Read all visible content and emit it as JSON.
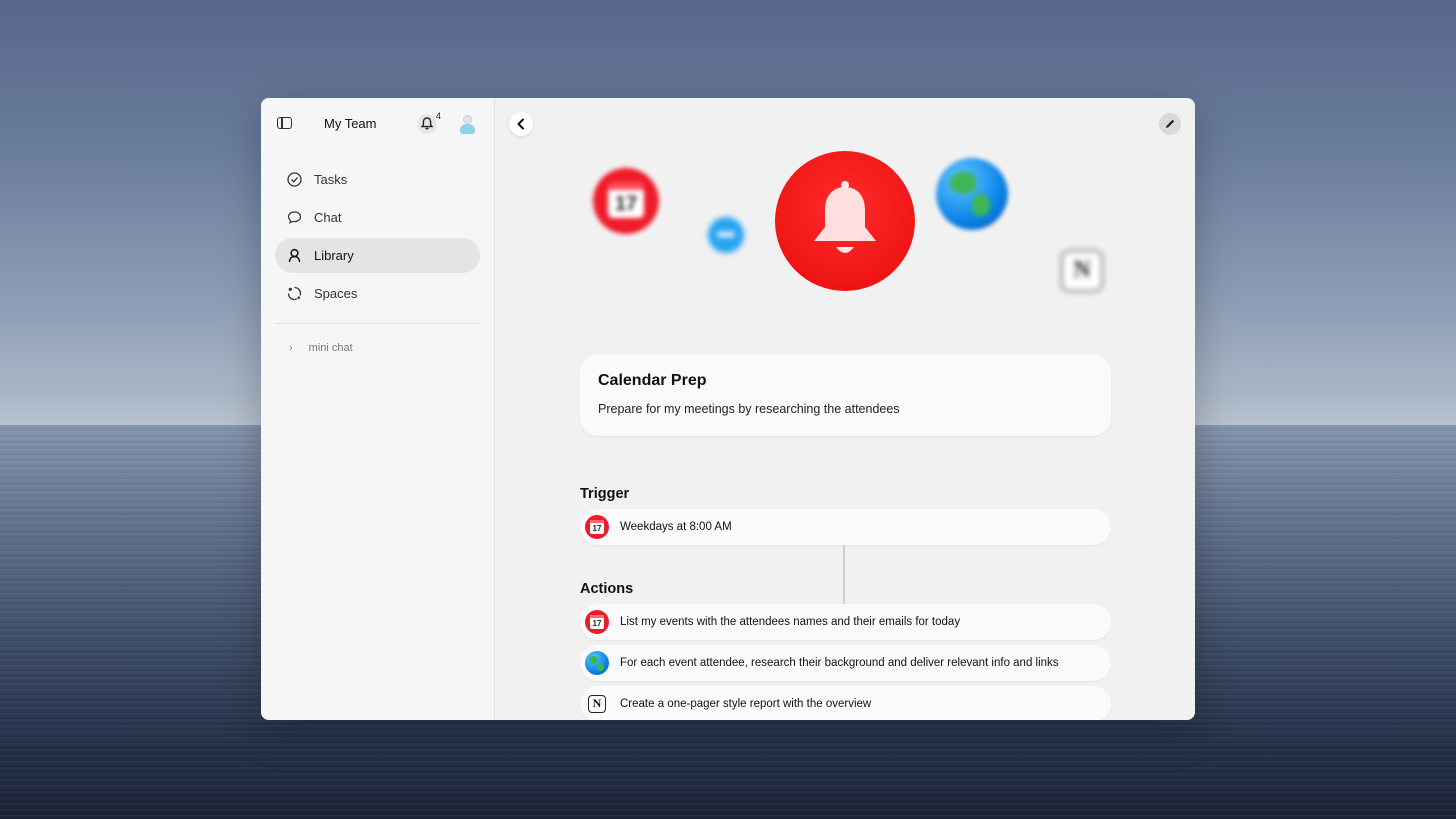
{
  "sidebar": {
    "team_name": "My Team",
    "notification_count": "4",
    "items": [
      {
        "label": "Tasks",
        "icon": "check-circle-icon"
      },
      {
        "label": "Chat",
        "icon": "chat-bubble-icon"
      },
      {
        "label": "Library",
        "icon": "person-icon",
        "active": true
      },
      {
        "label": "Spaces",
        "icon": "spaces-icon"
      }
    ],
    "mini_chat": "mini chat"
  },
  "hero_icons": {
    "calendar_date": "17",
    "notion_letter": "N"
  },
  "workflow": {
    "title": "Calendar Prep",
    "description": "Prepare for my meetings by researching the attendees",
    "trigger_heading": "Trigger",
    "trigger": {
      "icon": "calendar-icon",
      "date": "17",
      "text": "Weekdays at 8:00 AM"
    },
    "actions_heading": "Actions",
    "actions": [
      {
        "icon": "calendar-icon",
        "date": "17",
        "text": "List my events with the attendees names and their emails for today"
      },
      {
        "icon": "globe-icon",
        "text": "For each event attendee, research their background and deliver relevant info and links"
      },
      {
        "icon": "notion-icon",
        "letter": "N",
        "text": "Create a one-pager style report with the overview"
      }
    ]
  },
  "colors": {
    "accent_red": "#ee1b2a",
    "globe_blue": "#0b82e8",
    "sidebar_active": "#e4e4e4"
  }
}
